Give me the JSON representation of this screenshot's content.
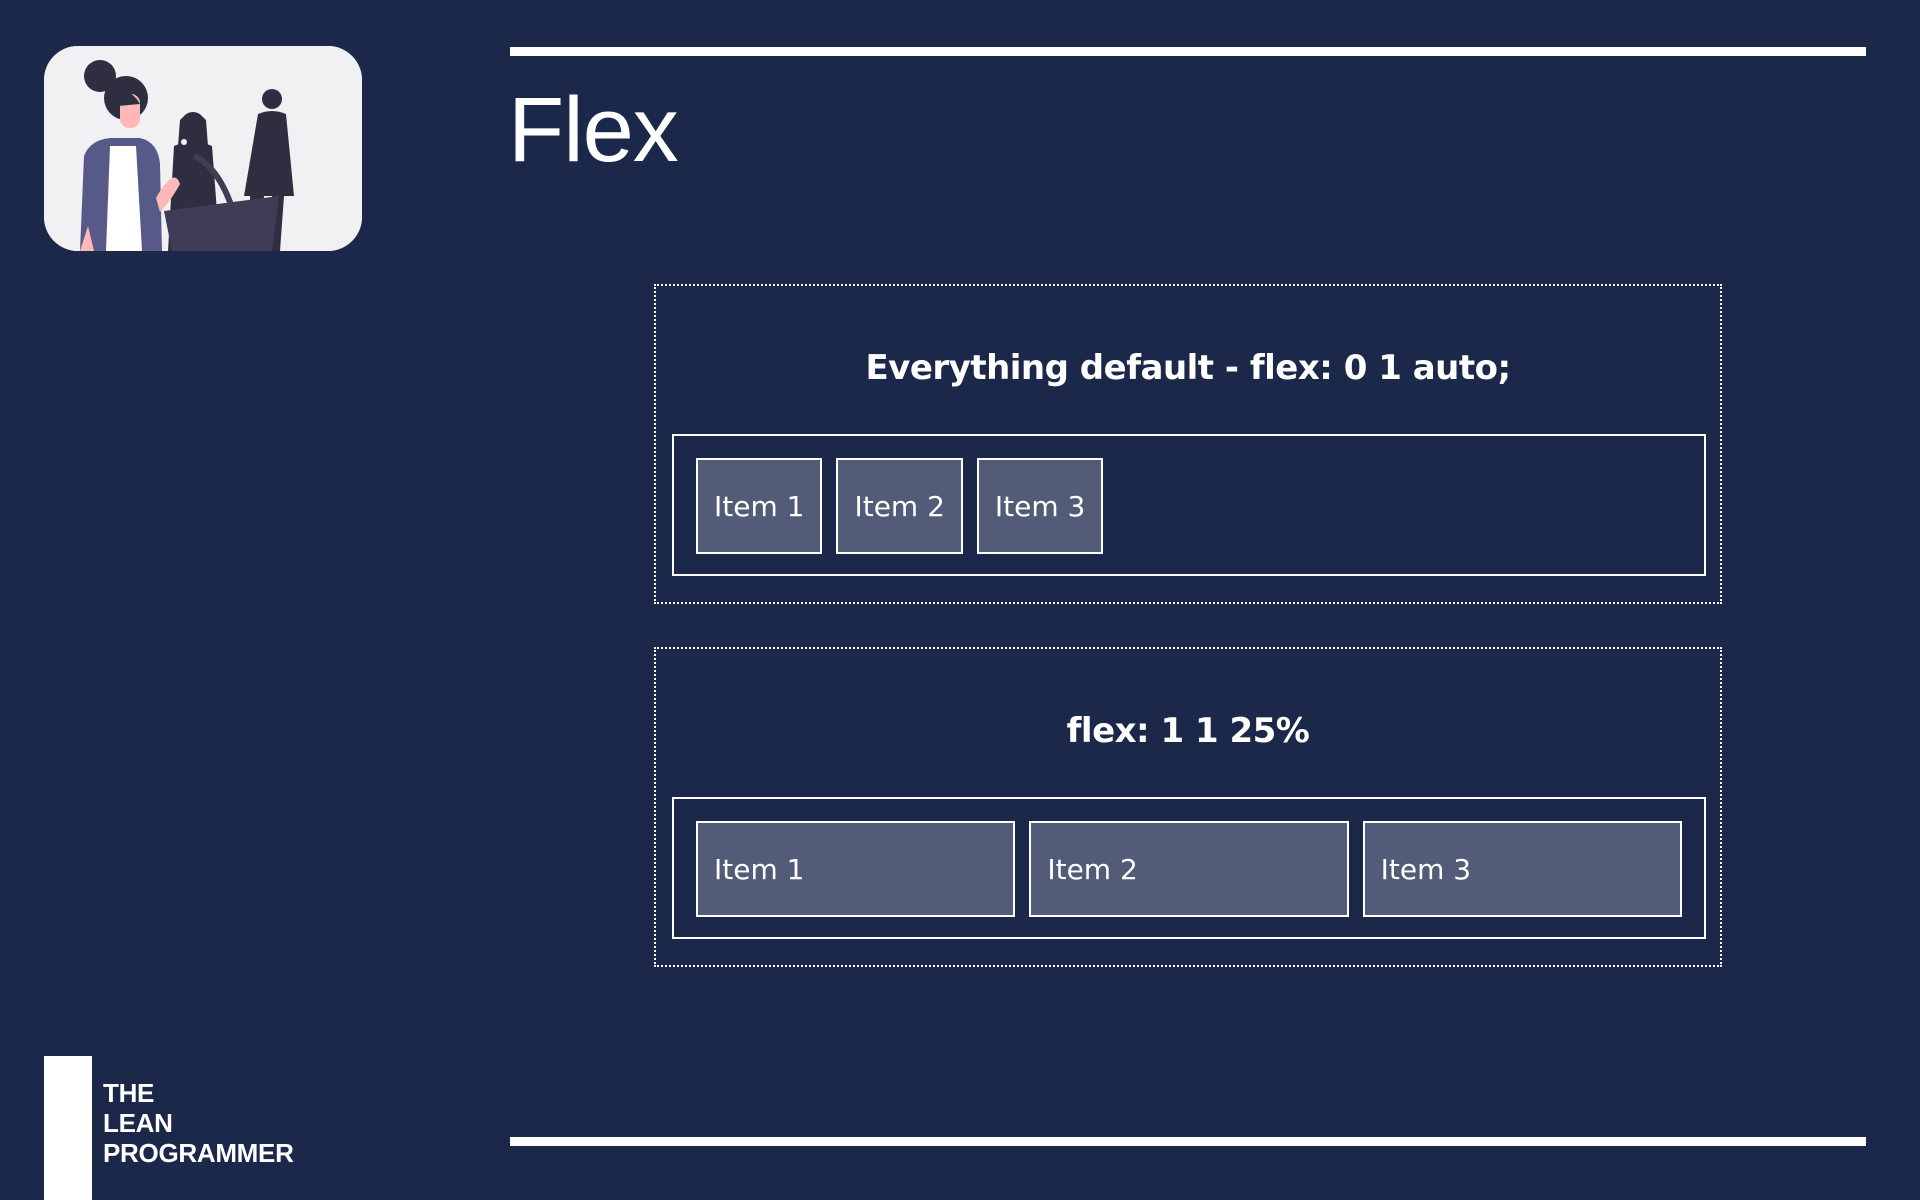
{
  "slide": {
    "title": "Flex",
    "background_color": "#1b284a",
    "item_color": "#525b77"
  },
  "hero": {
    "icon": "people-presentation-illustration"
  },
  "demos": [
    {
      "heading": "Everything default - flex: 0 1 auto;",
      "items": [
        "Item 1",
        "Item 2",
        "Item 3"
      ]
    },
    {
      "heading": "flex: 1 1 25%",
      "items": [
        "Item 1",
        "Item 2",
        "Item 3"
      ]
    }
  ],
  "brand": {
    "line1": "THE",
    "line2": "LEAN",
    "line3": "PROGRAMMER"
  }
}
